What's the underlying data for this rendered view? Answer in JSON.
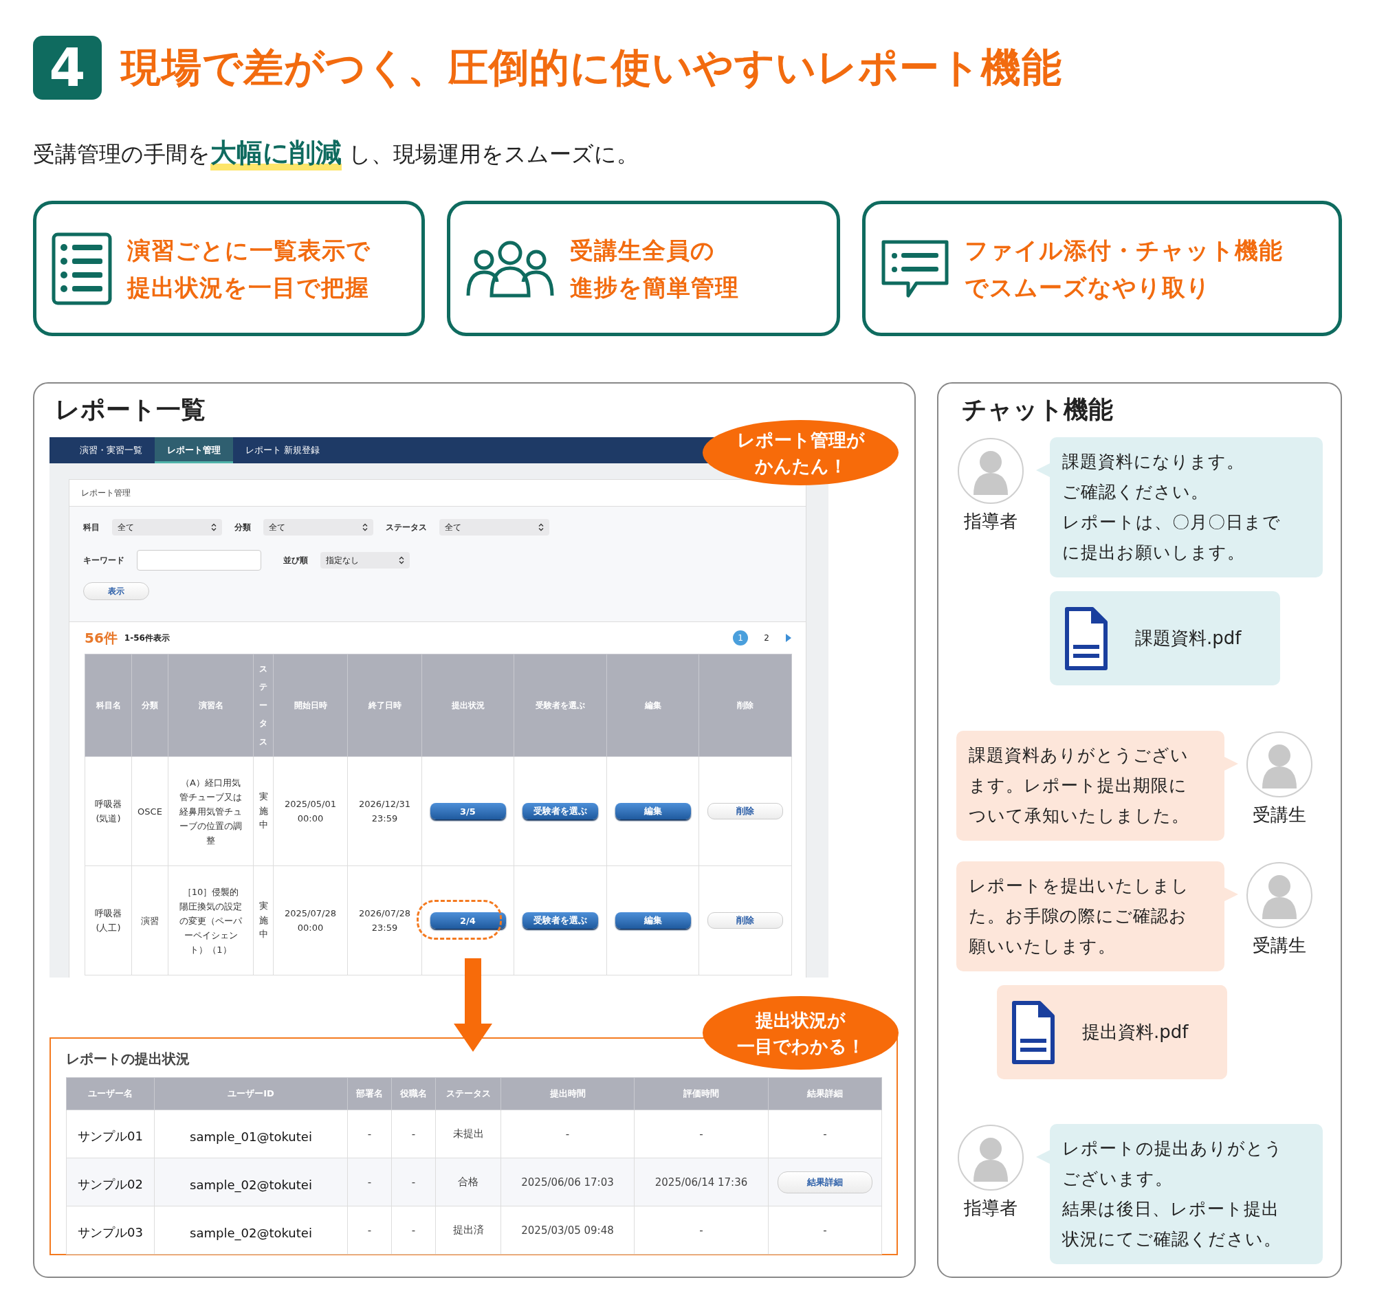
{
  "header": {
    "badge": "4",
    "title": "現場で差がつく、圧倒的に使いやすいレポート機能",
    "lead": "受講管理の手間を**大幅に削減** し、現場運用をスムーズに。"
  },
  "features": [
    {
      "kind": "list",
      "lines": [
        "演習ごとに一覧表示で",
        "提出状況を一目で把握"
      ]
    },
    {
      "kind": "people",
      "lines": [
        "受講生全員の",
        "進捗を簡単管理"
      ]
    },
    {
      "kind": "chat",
      "lines": [
        "ファイル添付・チャット機能",
        "でスムーズなやり取り"
      ]
    }
  ],
  "report_list": {
    "title": "レポート一覧",
    "callout": [
      "レポート管理が",
      "かんたん！"
    ],
    "nav": [
      {
        "label": "演習・実習一覧",
        "selected": false
      },
      {
        "label": "レポート管理",
        "selected": true
      },
      {
        "label": "レポート 新規登録",
        "selected": false
      }
    ],
    "card_title": "レポート管理",
    "filters": [
      {
        "label": "科目",
        "value": "全て"
      },
      {
        "label": "分類",
        "value": "全て"
      },
      {
        "label": "ステータス",
        "value": "全て"
      }
    ],
    "keyword": {
      "label": "キーワード"
    },
    "sort": {
      "label": "並び順",
      "value": "指定なし"
    },
    "show_button": "表示",
    "count": "56件",
    "range": "1-56件表示",
    "pages": [
      {
        "label": "1",
        "selected": true
      },
      {
        "label": "2",
        "selected": false
      }
    ],
    "columns": [
      "科目名",
      "分類",
      "演習名",
      "ステータス",
      "開始日時",
      "終了日時",
      "提出状況",
      "受験者を選ぶ",
      "編集",
      "削除"
    ],
    "rows": [
      {
        "subject": "呼吸器(気道)",
        "category": "OSCE",
        "exercise": "（A）経口用気管チューブ又は経鼻用気管チューブの位置の調整",
        "status": "実施中",
        "start": "2025/05/01 00:00",
        "end": "2026/12/31 23:59",
        "submissions": "3/5",
        "choose": "受験者を選ぶ",
        "edit": "編集",
        "delete": "削除",
        "highlighted": false
      },
      {
        "subject": "呼吸器(人工)",
        "category": "演習",
        "exercise": "［10］侵襲的陽圧換気の設定の変更（ペーパーペイシェント）（1）",
        "status": "実施中",
        "start": "2025/07/28 00:00",
        "end": "2026/07/28 23:59",
        "submissions": "2/4",
        "choose": "受験者を選ぶ",
        "edit": "編集",
        "delete": "削除",
        "highlighted": true
      }
    ]
  },
  "submission": {
    "title": "レポートの提出状況",
    "callout": [
      "提出状況が",
      "一目でわかる！"
    ],
    "columns": [
      "ユーザー名",
      "ユーザーID",
      "部署名",
      "役職名",
      "ステータス",
      "提出時間",
      "評価時間",
      "結果詳細"
    ],
    "rows": [
      {
        "name": "サンプル01",
        "user_id": "sample_01@tokutei",
        "department": "-",
        "role": "-",
        "status": "未提出",
        "submitted": "-",
        "evaluated": "-",
        "result": {
          "kind": "text",
          "label": "-"
        }
      },
      {
        "name": "サンプル02",
        "user_id": "sample_02@tokutei",
        "department": "-",
        "role": "-",
        "status": "合格",
        "submitted": "2025/06/06 17:03",
        "evaluated": "2025/06/14 17:36",
        "result": {
          "kind": "button",
          "label": "結果詳細"
        }
      },
      {
        "name": "サンプル03",
        "user_id": "sample_02@tokutei",
        "department": "-",
        "role": "-",
        "status": "提出済",
        "submitted": "2025/03/05 09:48",
        "evaluated": "-",
        "result": {
          "kind": "text",
          "label": "-"
        }
      }
    ]
  },
  "chat": {
    "title": "チャット機能",
    "messages": [
      {
        "kind": "text",
        "from_learner": false,
        "sender": "指導者",
        "lines": [
          "課題資料になります。",
          "ご確認ください。",
          "レポートは、〇月〇日までに提出お願いします。"
        ]
      },
      {
        "kind": "file",
        "from_learner": false,
        "name": "課題資料.pdf"
      },
      {
        "kind": "text",
        "from_learner": true,
        "sender": "受講生",
        "lines": [
          "課題資料ありがとうございます。レポート提出期限について承知いたしました。"
        ]
      },
      {
        "kind": "text",
        "from_learner": true,
        "sender": "受講生",
        "lines": [
          "レポートを提出いたしました。お手隙の際にご確認お願いいたします。"
        ]
      },
      {
        "kind": "file",
        "from_learner": true,
        "name": "提出資料.pdf"
      },
      {
        "kind": "text",
        "from_learner": false,
        "sender": "指導者",
        "lines": [
          "レポートの提出ありがとうございます。",
          "結果は後日、レポート提出状況にてご確認ください。"
        ]
      }
    ]
  }
}
